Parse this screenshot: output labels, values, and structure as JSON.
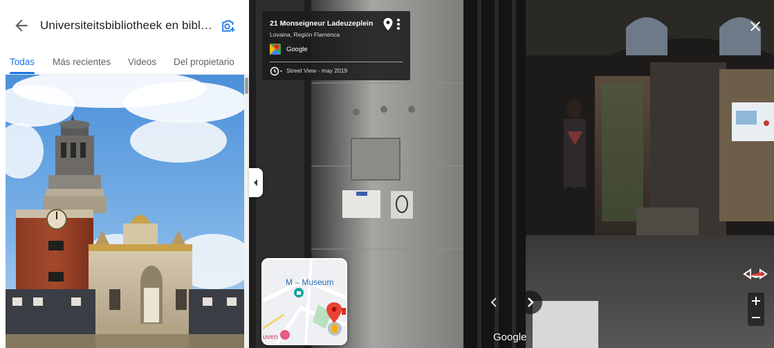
{
  "panel": {
    "title": "Universiteitsbibliotheek en biblio...",
    "back_icon": "arrow-back-icon",
    "add_photo_icon": "add-photo-icon",
    "tabs": [
      {
        "label": "Todas",
        "active": true
      },
      {
        "label": "Más recientes",
        "active": false
      },
      {
        "label": "Videos",
        "active": false
      },
      {
        "label": "Del propietario",
        "active": false
      }
    ],
    "accent_color": "#1a73e8"
  },
  "street_view": {
    "address": "21 Monseigneur Ladeuzeplein",
    "locality": "Lovaina, Región Flamenca",
    "provider": "Google",
    "date_label": "Street View - may 2019",
    "watermark": "Google",
    "minimap": {
      "label": "M – Museum",
      "partial_label": "uven"
    },
    "icons": [
      "pin-icon",
      "more-vert-icon",
      "google-maps-logo-icon",
      "history-icon",
      "close-icon",
      "compass-icon",
      "chevron-left-icon",
      "chevron-right-icon",
      "plus-icon",
      "minus-icon"
    ]
  }
}
